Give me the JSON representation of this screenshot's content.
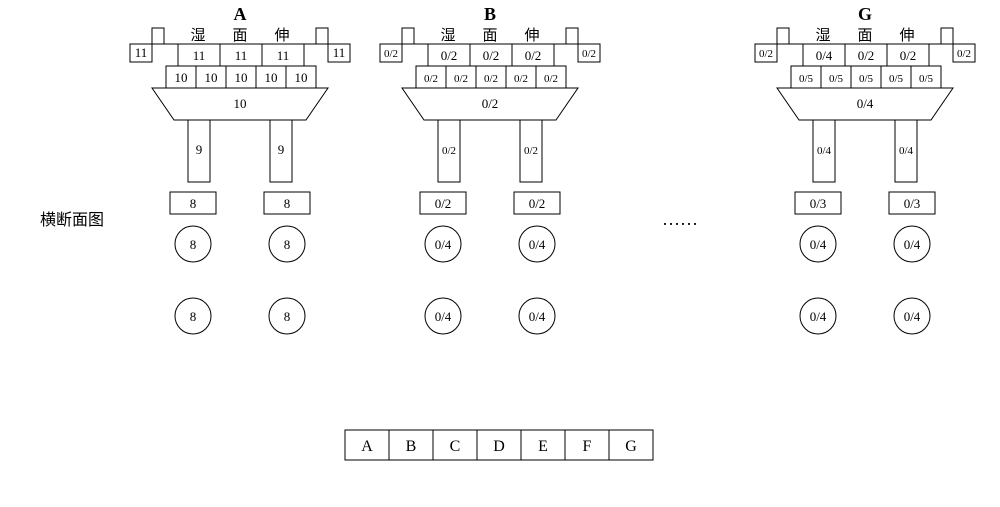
{
  "side_label": "横断面图",
  "ellipsis": "……",
  "hdr": {
    "h1": "湿",
    "h2": "面",
    "h3": "伸"
  },
  "col": {
    "A": {
      "title": "A",
      "tabL": "11",
      "tabR": "11",
      "r1a": "11",
      "r1b": "11",
      "r1c": "11",
      "r2a": "10",
      "r2b": "10",
      "r2c": "10",
      "r2d": "10",
      "r2e": "10",
      "cap": "10",
      "colL": "9",
      "colR": "9",
      "ftL": "8",
      "ftR": "8",
      "c1L": "8",
      "c1R": "8",
      "c2L": "8",
      "c2R": "8"
    },
    "B": {
      "title": "B",
      "tabL": "0/2",
      "tabR": "0/2",
      "r1a": "0/2",
      "r1b": "0/2",
      "r1c": "0/2",
      "r2a": "0/2",
      "r2b": "0/2",
      "r2c": "0/2",
      "r2d": "0/2",
      "r2e": "0/2",
      "cap": "0/2",
      "colL": "0/2",
      "colR": "0/2",
      "ftL": "0/2",
      "ftR": "0/2",
      "c1L": "0/4",
      "c1R": "0/4",
      "c2L": "0/4",
      "c2R": "0/4"
    },
    "G": {
      "title": "G",
      "tabL": "0/2",
      "tabR": "0/2",
      "r1a": "0/4",
      "r1b": "0/2",
      "r1c": "0/2",
      "r2a": "0/5",
      "r2b": "0/5",
      "r2c": "0/5",
      "r2d": "0/5",
      "r2e": "0/5",
      "cap": "0/4",
      "colL": "0/4",
      "colR": "0/4",
      "ftL": "0/3",
      "ftR": "0/3",
      "c1L": "0/4",
      "c1R": "0/4",
      "c2L": "0/4",
      "c2R": "0/4"
    }
  },
  "legend": {
    "a": "A",
    "b": "B",
    "c": "C",
    "d": "D",
    "e": "E",
    "f": "F",
    "g": "G"
  }
}
